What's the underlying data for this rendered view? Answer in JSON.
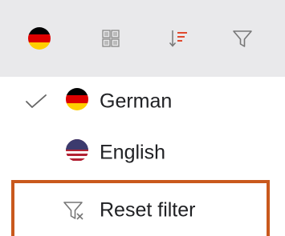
{
  "toolbar": {
    "language_button": {
      "icon": "german-flag-icon",
      "colors": [
        "#000000",
        "#dd0000",
        "#ffce00"
      ]
    },
    "layout_button": {
      "icon": "grid-view-icon"
    },
    "sort_button": {
      "icon": "sort-descending-icon",
      "accent": "#e0492f"
    },
    "filter_button": {
      "icon": "filter-funnel-icon"
    }
  },
  "language_menu": {
    "items": [
      {
        "label": "German",
        "icon": "german-flag-icon",
        "selected": true
      },
      {
        "label": "English",
        "icon": "us-flag-icon",
        "selected": false
      }
    ],
    "reset": {
      "label": "Reset filter",
      "icon": "filter-clear-icon",
      "highlight_color": "#c9591d"
    }
  }
}
